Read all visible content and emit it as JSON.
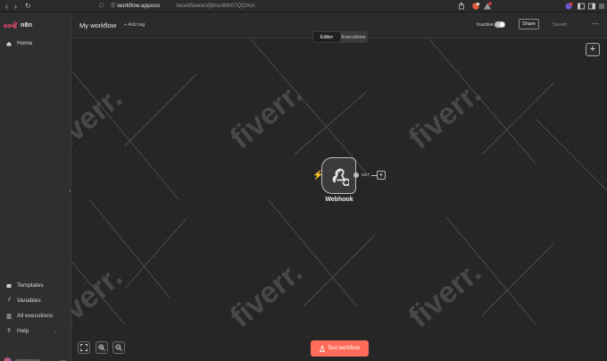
{
  "browser": {
    "url_host": "workflow.appoos",
    "url_path": "/workflow/eVj8nsnfbh07QOXm"
  },
  "logo": {
    "text": "n8n"
  },
  "sidebar": {
    "home": "Home",
    "templates": "Templates",
    "variables": "Variables",
    "all_executions": "All executions",
    "help": "Help"
  },
  "header": {
    "workflow_name": "My workflow",
    "add_tag": "+ Add tag",
    "active_status": "Inactive",
    "share": "Share",
    "saved": "Saved"
  },
  "canvas": {
    "tabs": [
      "Editor",
      "Executions"
    ],
    "active_tab": "Editor",
    "watermark": "fiverr.",
    "node": {
      "label": "Webhook",
      "method": "GET"
    },
    "test_button": "Test workflow"
  },
  "colors": {
    "accent": "#ff6d5a",
    "canvas_bg": "#262626",
    "sidebar_bg": "#2f2f2f"
  }
}
